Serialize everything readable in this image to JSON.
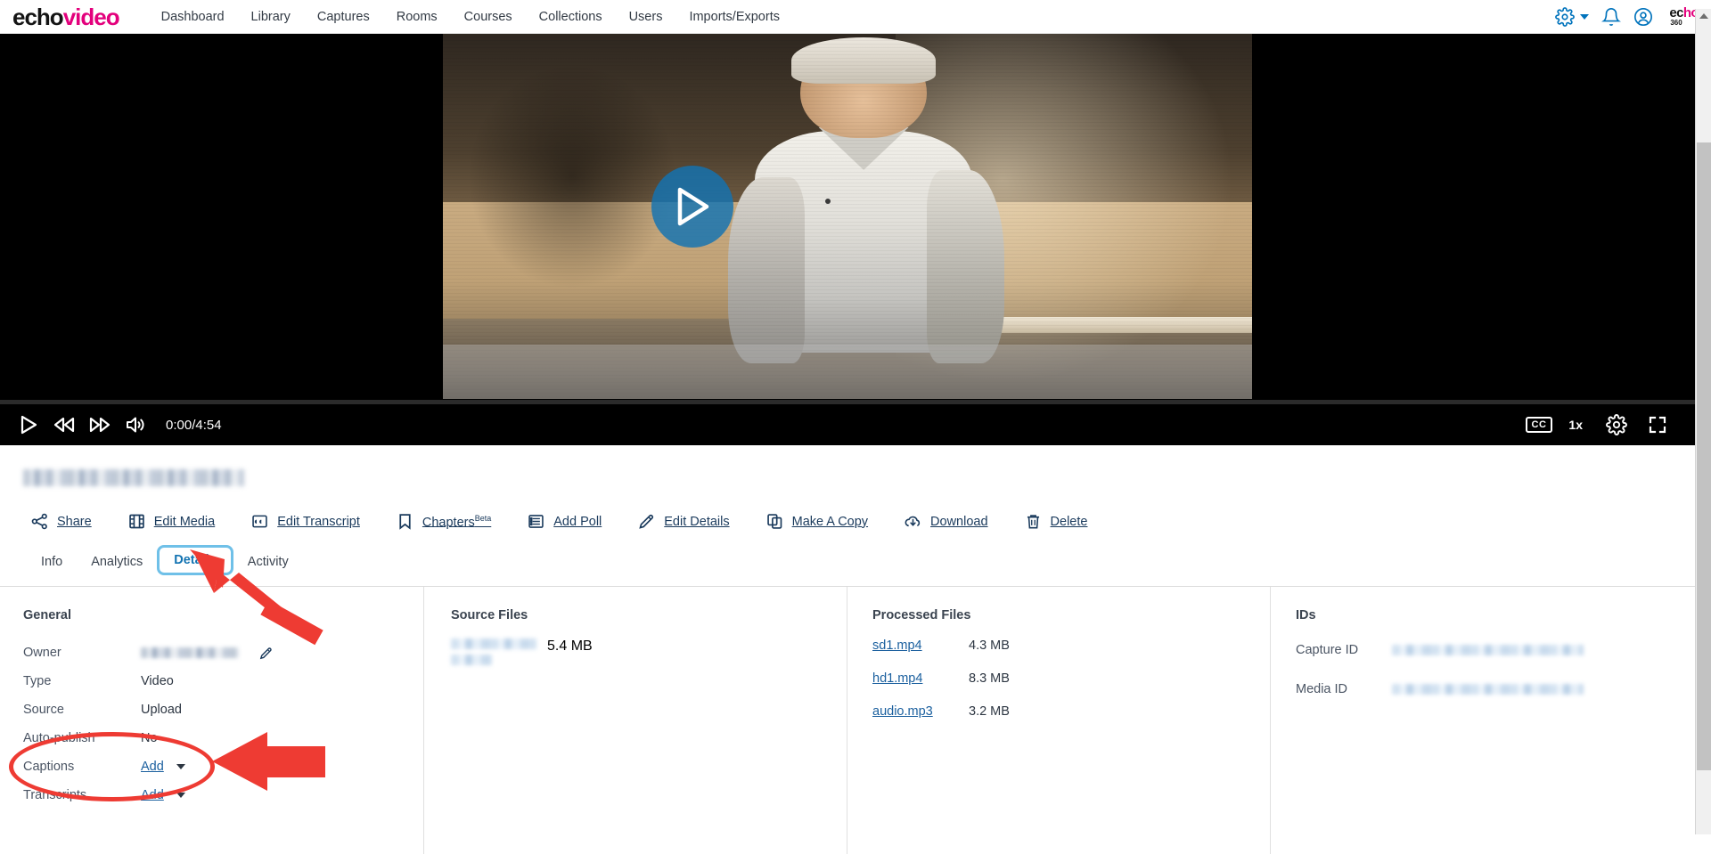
{
  "brand": {
    "part1": "echo",
    "part2": "video"
  },
  "topnav": {
    "items": [
      {
        "label": "Dashboard"
      },
      {
        "label": "Library"
      },
      {
        "label": "Captures"
      },
      {
        "label": "Rooms"
      },
      {
        "label": "Courses"
      },
      {
        "label": "Collections"
      },
      {
        "label": "Users"
      },
      {
        "label": "Imports/Exports"
      }
    ],
    "right_icons": [
      "gear-icon",
      "chevron-down-icon",
      "bell-icon",
      "user-avatar-icon"
    ],
    "logo": {
      "top": "echo",
      "top_accent": "360",
      "bottom": "360"
    }
  },
  "player": {
    "play_overlay": "play-button-overlay",
    "controls_left": [
      "play-icon",
      "rewind-icon",
      "fast-forward-icon",
      "volume-icon"
    ],
    "timecode": "0:00/4:54",
    "current_time": "0:00",
    "duration": "4:54",
    "progress_percent": 0,
    "cc_label": "CC",
    "speed_label": "1x",
    "controls_right": [
      "cc-badge",
      "speed",
      "settings-gear-icon",
      "fullscreen-icon"
    ]
  },
  "media": {
    "title_redacted": true,
    "title": ""
  },
  "actions": [
    {
      "label": "Share",
      "icon": "share-icon",
      "sup": ""
    },
    {
      "label": "Edit Media",
      "icon": "film-icon",
      "sup": ""
    },
    {
      "label": "Edit Transcript",
      "icon": "quote-icon",
      "sup": ""
    },
    {
      "label": "Chapters",
      "icon": "bookmark-icon",
      "sup": "Beta"
    },
    {
      "label": "Add Poll",
      "icon": "list-icon",
      "sup": ""
    },
    {
      "label": "Edit Details",
      "icon": "pencil-icon",
      "sup": ""
    },
    {
      "label": "Make A Copy",
      "icon": "copy-icon",
      "sup": ""
    },
    {
      "label": "Download",
      "icon": "download-cloud-icon",
      "sup": ""
    },
    {
      "label": "Delete",
      "icon": "trash-icon",
      "sup": ""
    }
  ],
  "tabs": [
    {
      "label": "Info",
      "active": false
    },
    {
      "label": "Analytics",
      "active": false
    },
    {
      "label": "Details",
      "active": true
    },
    {
      "label": "Activity",
      "active": false
    }
  ],
  "details": {
    "general": {
      "heading": "General",
      "rows": [
        {
          "key": "Owner",
          "value": "",
          "redacted": true,
          "edit_icon": "pencil-icon"
        },
        {
          "key": "Type",
          "value": "Video",
          "redacted": false
        },
        {
          "key": "Source",
          "value": "Upload",
          "redacted": false
        },
        {
          "key": "Auto-publish",
          "value": "No",
          "redacted": false
        },
        {
          "key": "Captions",
          "value": "Add",
          "link": true,
          "dropdown": true
        },
        {
          "key": "Transcripts",
          "value": "Add",
          "link": true,
          "dropdown": true
        }
      ]
    },
    "source_files": {
      "heading": "Source Files",
      "rows": [
        {
          "name": "",
          "redacted": true,
          "size": "5.4 MB"
        }
      ]
    },
    "processed_files": {
      "heading": "Processed Files",
      "rows": [
        {
          "name": "sd1.mp4",
          "size": "4.3 MB"
        },
        {
          "name": "hd1.mp4",
          "size": "8.3 MB"
        },
        {
          "name": "audio.mp3",
          "size": "3.2 MB"
        }
      ]
    },
    "ids": {
      "heading": "IDs",
      "rows": [
        {
          "key": "Capture ID",
          "value": "",
          "redacted": true
        },
        {
          "key": "Media ID",
          "value": "",
          "redacted": true
        }
      ]
    }
  },
  "annotations": {
    "color": "#ee3b33",
    "highlight_color": "#6fc0e8",
    "items": [
      {
        "type": "arrow",
        "target": "details-tab"
      },
      {
        "type": "ellipse",
        "target": "captions-row"
      },
      {
        "type": "arrow",
        "target": "captions-row"
      },
      {
        "type": "box",
        "target": "details-tab"
      }
    ]
  }
}
